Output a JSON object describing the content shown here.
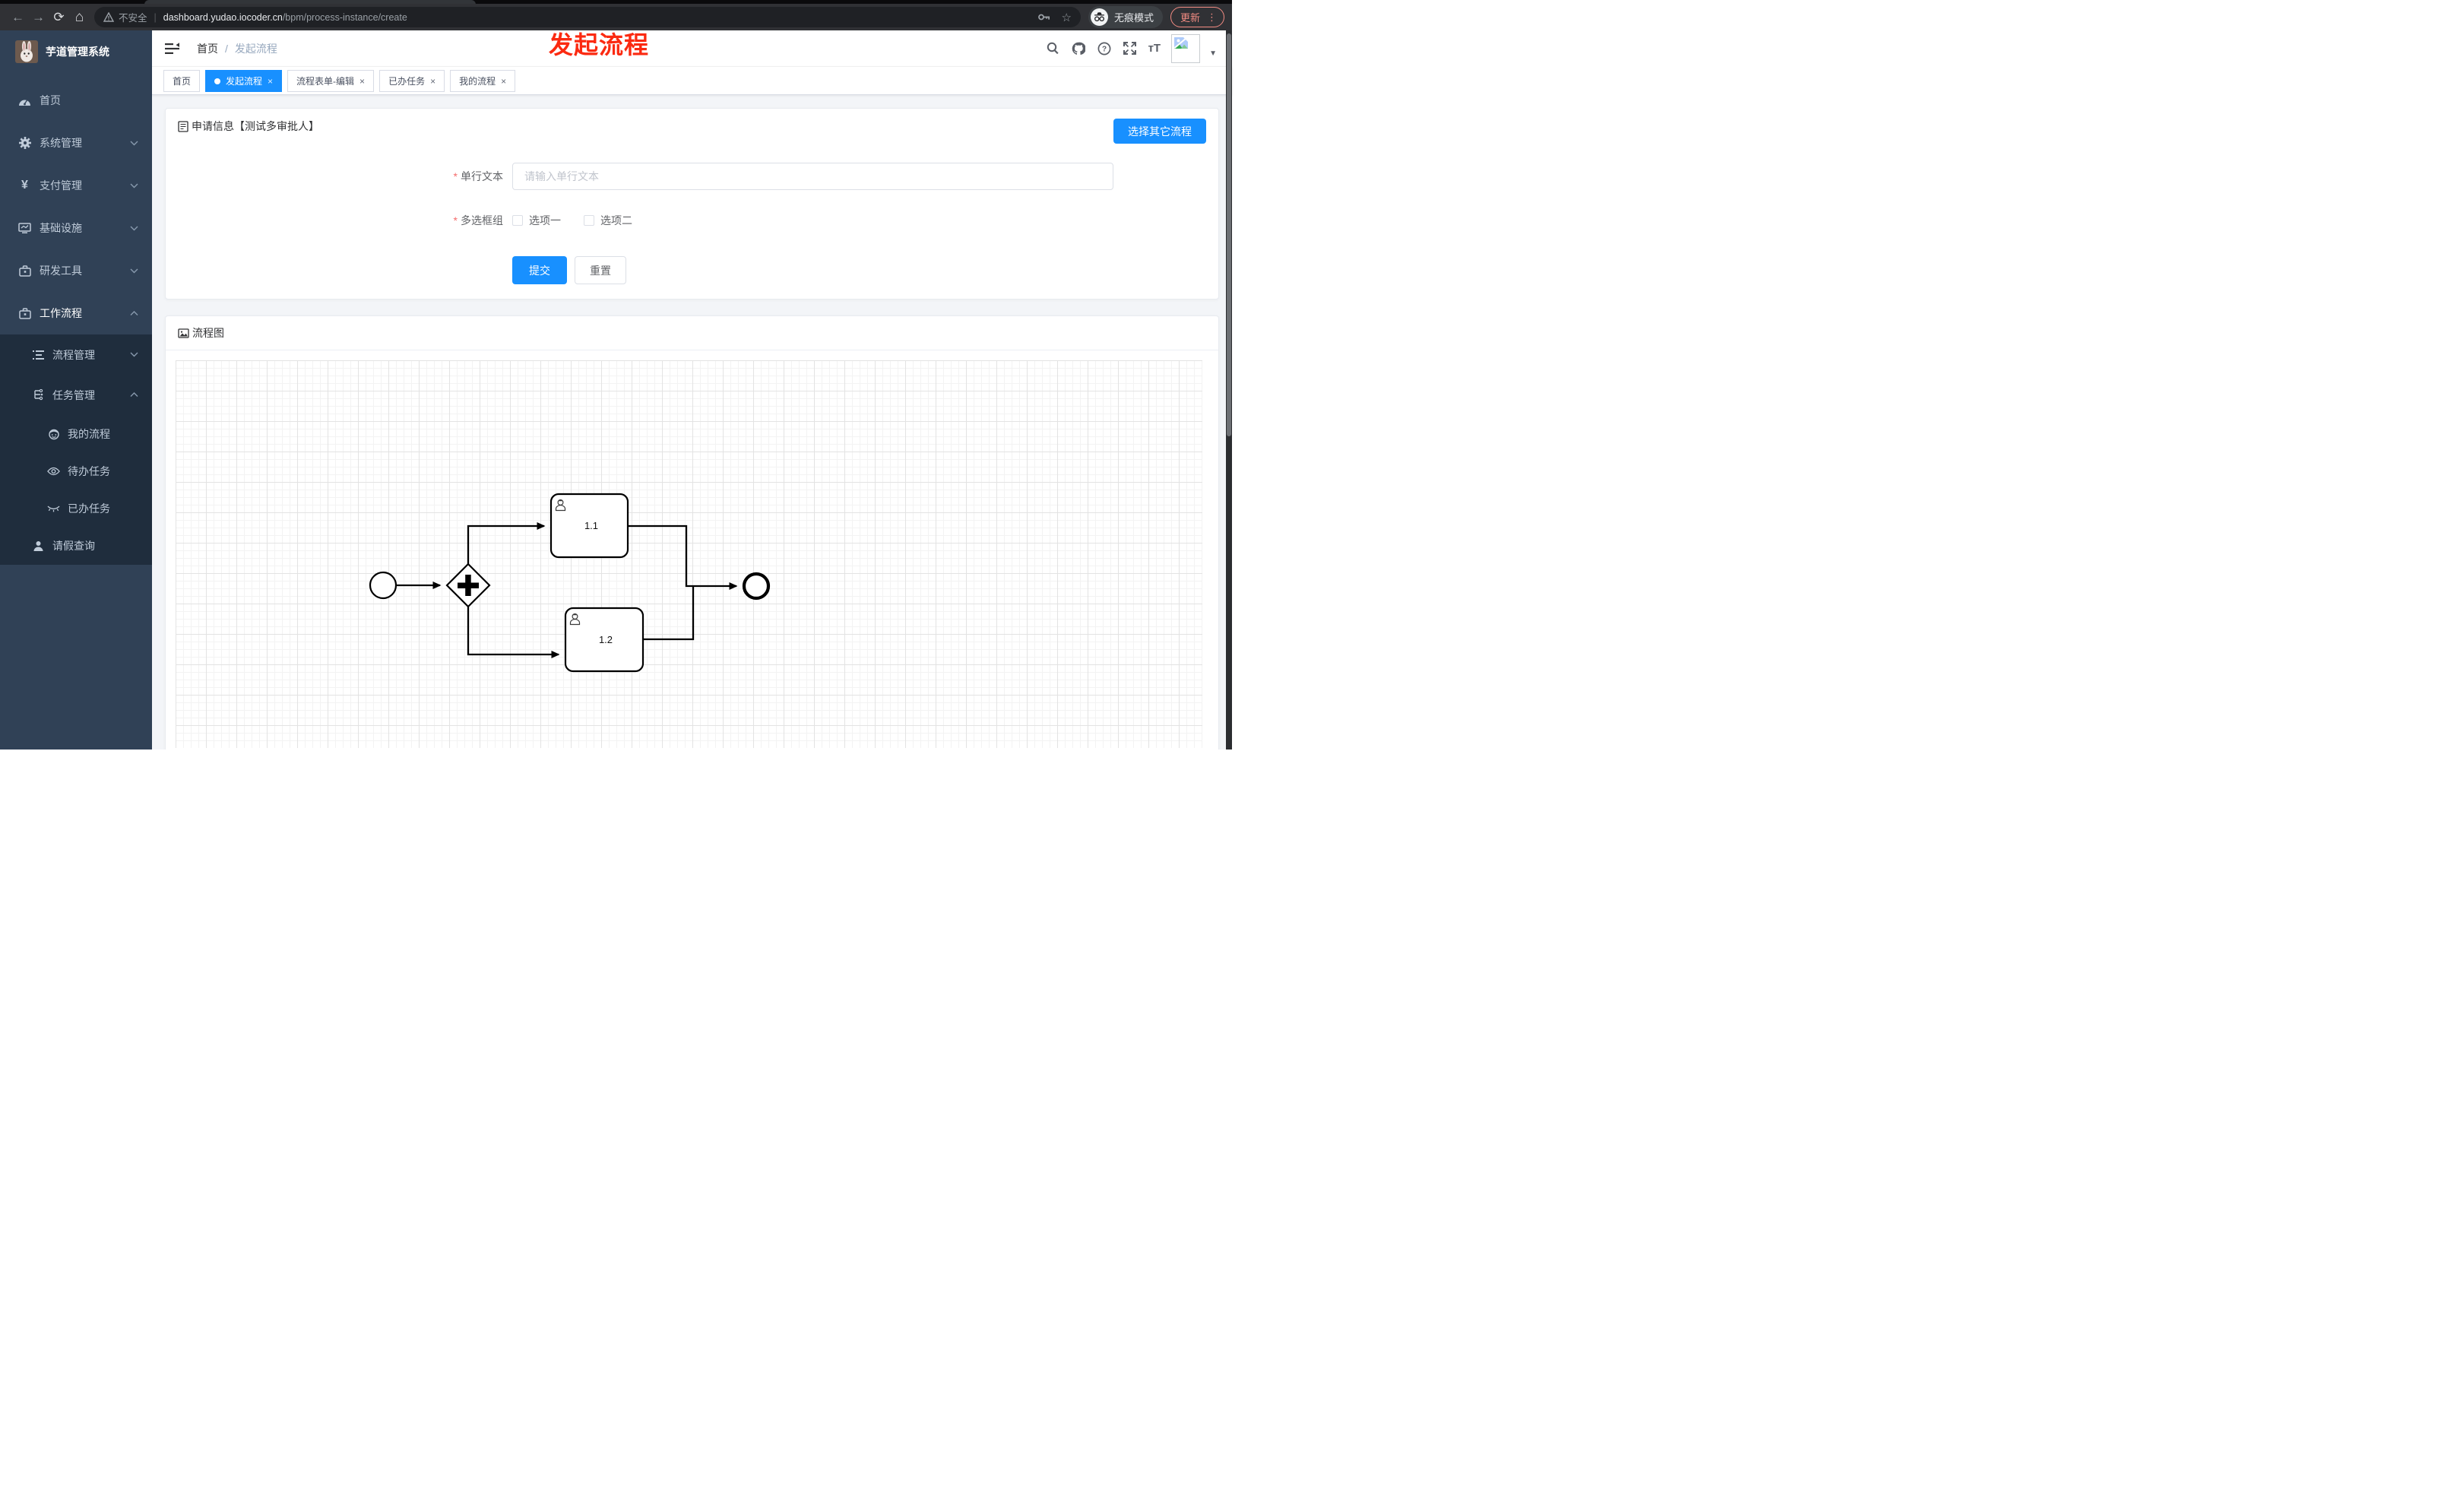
{
  "browser": {
    "security_label": "不安全",
    "url_domain": "dashboard.yudao.iocoder.cn",
    "url_path": "/bpm/process-instance/create",
    "incognito_label": "无痕模式",
    "update_label": "更新"
  },
  "overlay": {
    "title": "发起流程"
  },
  "sidebar": {
    "app_title": "芋道管理系统",
    "items": [
      {
        "label": "首页"
      },
      {
        "label": "系统管理"
      },
      {
        "label": "支付管理"
      },
      {
        "label": "基础设施"
      },
      {
        "label": "研发工具"
      },
      {
        "label": "工作流程"
      }
    ],
    "submenu": [
      {
        "label": "流程管理"
      },
      {
        "label": "任务管理"
      }
    ],
    "task_items": [
      {
        "label": "我的流程"
      },
      {
        "label": "待办任务"
      },
      {
        "label": "已办任务"
      }
    ],
    "leave_item": {
      "label": "请假查询"
    },
    "pay_icon_glyph": "¥"
  },
  "header": {
    "breadcrumb": [
      "首页",
      "发起流程"
    ],
    "separator": "/"
  },
  "tabs": [
    {
      "label": "首页"
    },
    {
      "label": "发起流程"
    },
    {
      "label": "流程表单-编辑"
    },
    {
      "label": "已办任务"
    },
    {
      "label": "我的流程"
    }
  ],
  "ui": {
    "close_glyph": "×",
    "caret_glyph": "▼",
    "kebab_glyph": "⋮",
    "star_glyph": "☆",
    "back_glyph": "←",
    "forward_glyph": "→",
    "reload_glyph": "⟳",
    "home_glyph": "⌂",
    "font_size_glyph": "тT"
  },
  "apply_card": {
    "title": "申请信息【测试多审批人】",
    "select_other_button": "选择其它流程",
    "required_mark": "*",
    "fields": {
      "text_label": "单行文本",
      "text_placeholder": "请输入单行文本",
      "checkbox_label": "多选框组",
      "options": [
        "选项一",
        "选项二"
      ]
    },
    "submit_button": "提交",
    "reset_button": "重置"
  },
  "diagram_card": {
    "title": "流程图",
    "nodes": {
      "task1": "1.1",
      "task2": "1.2"
    }
  },
  "colors": {
    "accent": "#1890ff",
    "sidebar_bg": "#304156",
    "submenu_bg": "#1f2d3d",
    "danger": "#f56c6c",
    "overlay_red": "#fb2a11"
  }
}
